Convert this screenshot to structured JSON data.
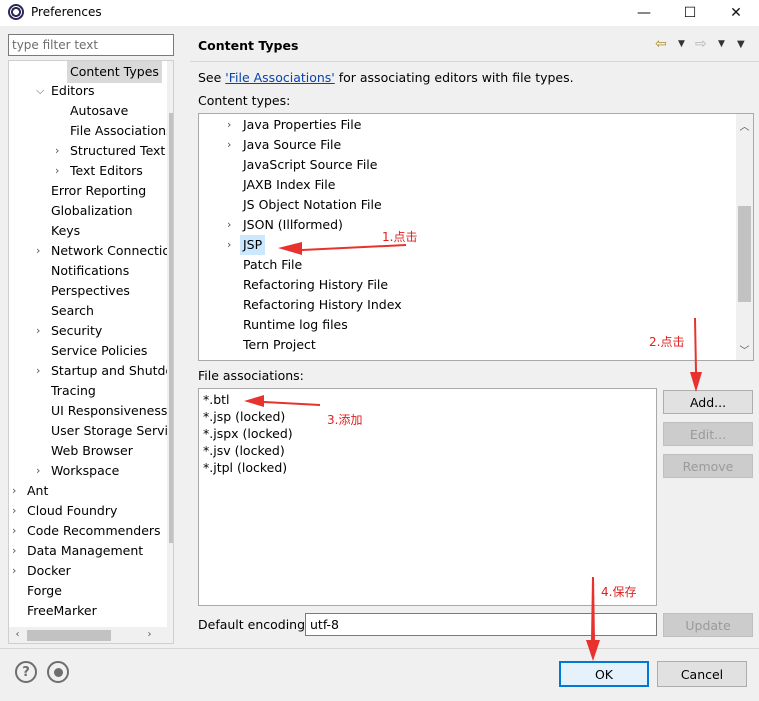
{
  "window": {
    "title": "Preferences",
    "controls": {
      "minimize": "—",
      "maximize": "☐",
      "close": "✕"
    }
  },
  "filter": {
    "placeholder": "type filter text"
  },
  "tree": {
    "items": [
      {
        "label": "Content Types",
        "indent": 2,
        "twisty": "",
        "selected": true
      },
      {
        "label": "Editors",
        "indent": 1,
        "twisty": "⌵"
      },
      {
        "label": "Autosave",
        "indent": 2,
        "twisty": ""
      },
      {
        "label": "File Associations",
        "indent": 2,
        "twisty": ""
      },
      {
        "label": "Structured Text Editors",
        "indent": 2,
        "twisty": "›"
      },
      {
        "label": "Text Editors",
        "indent": 2,
        "twisty": "›"
      },
      {
        "label": "Error Reporting",
        "indent": 1,
        "twisty": ""
      },
      {
        "label": "Globalization",
        "indent": 1,
        "twisty": ""
      },
      {
        "label": "Keys",
        "indent": 1,
        "twisty": ""
      },
      {
        "label": "Network Connections",
        "indent": 1,
        "twisty": "›"
      },
      {
        "label": "Notifications",
        "indent": 1,
        "twisty": ""
      },
      {
        "label": "Perspectives",
        "indent": 1,
        "twisty": ""
      },
      {
        "label": "Search",
        "indent": 1,
        "twisty": ""
      },
      {
        "label": "Security",
        "indent": 1,
        "twisty": "›"
      },
      {
        "label": "Service Policies",
        "indent": 1,
        "twisty": ""
      },
      {
        "label": "Startup and Shutdown",
        "indent": 1,
        "twisty": "›"
      },
      {
        "label": "Tracing",
        "indent": 1,
        "twisty": ""
      },
      {
        "label": "UI Responsiveness",
        "indent": 1,
        "twisty": ""
      },
      {
        "label": "User Storage Service",
        "indent": 1,
        "twisty": ""
      },
      {
        "label": "Web Browser",
        "indent": 1,
        "twisty": ""
      },
      {
        "label": "Workspace",
        "indent": 1,
        "twisty": "›"
      },
      {
        "label": "Ant",
        "indent": 0,
        "twisty": "›"
      },
      {
        "label": "Cloud Foundry",
        "indent": 0,
        "twisty": "›"
      },
      {
        "label": "Code Recommenders",
        "indent": 0,
        "twisty": "›"
      },
      {
        "label": "Data Management",
        "indent": 0,
        "twisty": "›"
      },
      {
        "label": "Docker",
        "indent": 0,
        "twisty": "›"
      },
      {
        "label": "Forge",
        "indent": 0,
        "twisty": ""
      },
      {
        "label": "FreeMarker",
        "indent": 0,
        "twisty": ""
      }
    ]
  },
  "page": {
    "title": "Content Types",
    "see_prefix": "See ",
    "see_link": "'File Associations'",
    "see_suffix": " for associating editors with file types.",
    "content_types_label": "Content types:",
    "file_assoc_label": "File associations:",
    "encoding_label": "Default encoding:",
    "encoding_value": "utf-8"
  },
  "content_types": [
    {
      "label": "Java Properties File",
      "twisty": "›"
    },
    {
      "label": "Java Source File",
      "twisty": "›"
    },
    {
      "label": "JavaScript Source File",
      "twisty": ""
    },
    {
      "label": "JAXB Index File",
      "twisty": ""
    },
    {
      "label": "JS Object Notation File",
      "twisty": ""
    },
    {
      "label": "JSON (Illformed)",
      "twisty": "›"
    },
    {
      "label": "JSP",
      "twisty": "›",
      "selected": true
    },
    {
      "label": "Patch File",
      "twisty": ""
    },
    {
      "label": "Refactoring History File",
      "twisty": ""
    },
    {
      "label": "Refactoring History Index",
      "twisty": ""
    },
    {
      "label": "Runtime log files",
      "twisty": ""
    },
    {
      "label": "Tern Project",
      "twisty": ""
    }
  ],
  "file_associations": [
    "*.btl",
    "*.jsp (locked)",
    "*.jspx (locked)",
    "*.jsv (locked)",
    "*.jtpl (locked)"
  ],
  "buttons": {
    "add": "Add...",
    "edit": "Edit...",
    "remove": "Remove",
    "update": "Update",
    "ok": "OK",
    "cancel": "Cancel"
  },
  "annotations": {
    "step1": "1.点击",
    "step2": "2.点击",
    "step3": "3.添加",
    "step4": "4.保存",
    "color": "#e8322e"
  },
  "icons": {
    "help": "?",
    "back": "⇦",
    "forward": "⇨",
    "menu": "▼"
  }
}
